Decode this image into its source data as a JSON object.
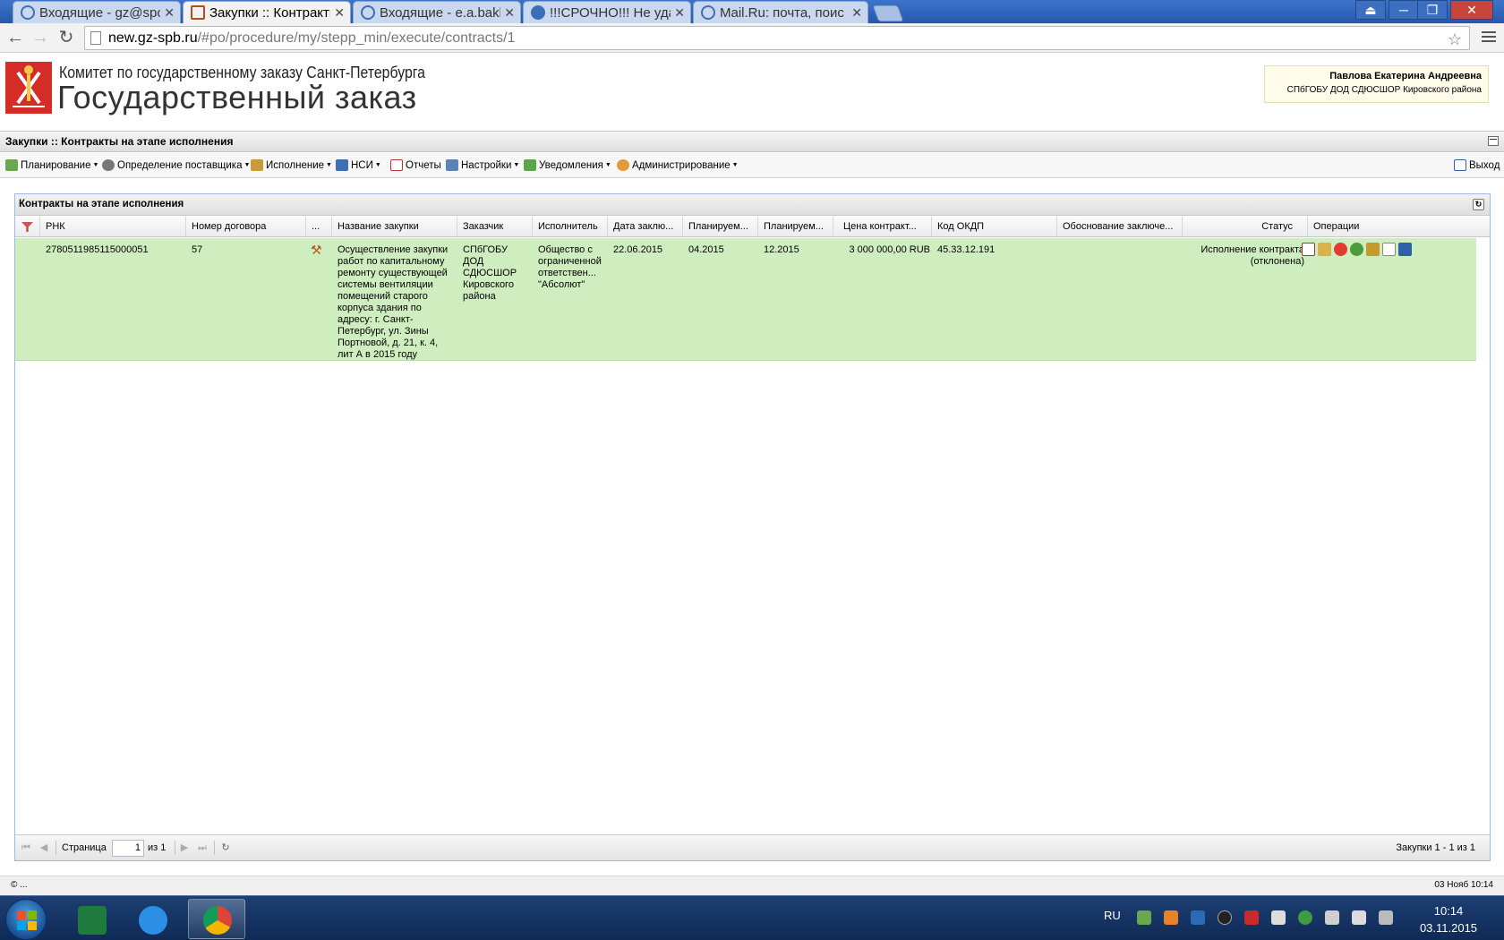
{
  "browser": {
    "tabs": [
      {
        "title": "Входящие - gz@spo"
      },
      {
        "title": "Закупки :: Контракты"
      },
      {
        "title": "Входящие - e.a.bakla"
      },
      {
        "title": "!!!СРОЧНО!!! Не уда"
      },
      {
        "title": "Mail.Ru: почта, поис"
      }
    ],
    "url_host": "new.gz-spb.ru",
    "url_path": "/#po/procedure/my/stepp_min/execute/contracts/1"
  },
  "header": {
    "org": "Комитет по государственному заказу Санкт-Петербурга",
    "title": "Государственный заказ",
    "user_name": "Павлова Екатерина Андреевна",
    "user_org": "СПбГОБУ ДОД СДЮСШОР Кировского района"
  },
  "app": {
    "breadcrumb": "Закупки :: Контракты на этапе исполнения",
    "menu": {
      "planning": "Планирование",
      "supplier": "Определение поставщика",
      "execution": "Исполнение",
      "nsi": "НСИ",
      "reports": "Отчеты",
      "settings": "Настройки",
      "notifications": "Уведомления",
      "admin": "Администрирование",
      "logout": "Выход"
    }
  },
  "grid": {
    "title": "Контракты на этапе исполнения",
    "columns": {
      "rnk": "РНК",
      "contract_no": "Номер договора",
      "dots": "...",
      "name": "Название закупки",
      "customer": "Заказчик",
      "executor": "Исполнитель",
      "date": "Дата заклю...",
      "plan1": "Планируем...",
      "plan2": "Планируем...",
      "price": "Цена контракт...",
      "okdp": "Код ОКДП",
      "basis": "Обоснование заключе...",
      "status": "Статус",
      "ops": "Операции"
    },
    "row": {
      "rnk": "2780511985115000051",
      "contract_no": "57",
      "name": "Осуществление закупки работ по капитальному ремонту существующей системы вентиляции помещений старого корпуса здания по адресу: г. Санкт-Петербург, ул. Зины Портновой, д. 21, к. 4, лит А в 2015 году",
      "customer": "СПбГОБУ ДОД СДЮСШОР Кировского района",
      "executor": "Общество с ограниченной ответствен... \"Абсолют\"",
      "date": "22.06.2015",
      "plan1": "04.2015",
      "plan2": "12.2015",
      "price": "3 000 000,00 RUB",
      "okdp": "45.33.12.191",
      "basis": "",
      "status": "Исполнение контракта (отклонена)"
    },
    "paging": {
      "page_label": "Страница",
      "page": "1",
      "of": "из 1",
      "summary": "Закупки 1 - 1 из 1"
    }
  },
  "footer": {
    "copyright": "© ...",
    "datetime": "03 Нояб 10:14"
  },
  "taskbar": {
    "lang": "RU",
    "time": "10:14",
    "date": "03.11.2015"
  },
  "colors": {
    "row_bg": "#cfeebf",
    "accent": "#99bbe8",
    "logo_red": "#d42d27"
  }
}
